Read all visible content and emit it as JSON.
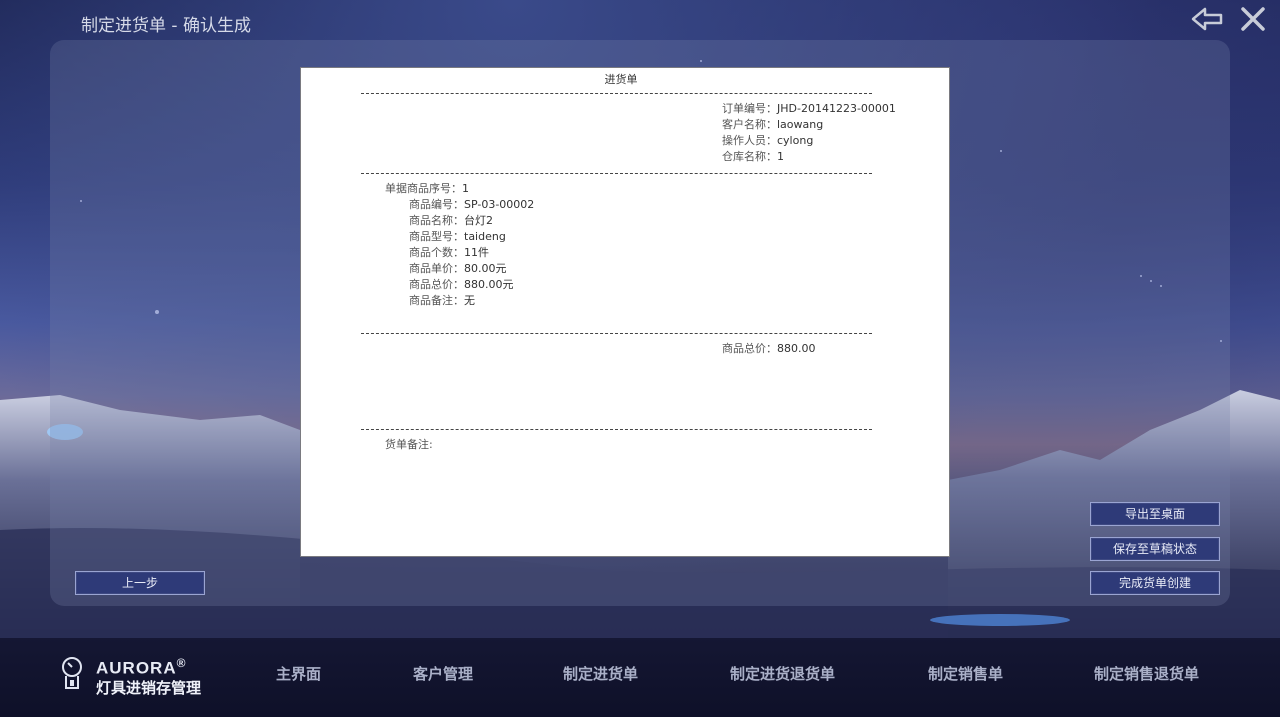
{
  "window": {
    "title": "制定进货单 - 确认生成"
  },
  "topbar": {
    "back_icon": "back-arrow-icon",
    "close_icon": "close-icon"
  },
  "document": {
    "title": "进货单",
    "header": [
      {
        "label": "订单编号：",
        "value": "JHD-20141223-00001"
      },
      {
        "label": "客户名称：",
        "value": "laowang"
      },
      {
        "label": "操作人员：",
        "value": "cylong"
      },
      {
        "label": "仓库名称：",
        "value": "1"
      }
    ],
    "item": {
      "seq_label": "单据商品序号：",
      "seq_value": "1",
      "fields": [
        {
          "label": "商品编号：",
          "value": "SP-03-00002"
        },
        {
          "label": "商品名称：",
          "value": "台灯2"
        },
        {
          "label": "商品型号：",
          "value": "taideng"
        },
        {
          "label": "商品个数：",
          "value": "11件"
        },
        {
          "label": "商品单价：",
          "value": "80.00元"
        },
        {
          "label": "商品总价：",
          "value": "880.00元"
        },
        {
          "label": "商品备注：",
          "value": "无"
        }
      ]
    },
    "total": {
      "label": "商品总价：",
      "value": "880.00"
    },
    "remark_label": "货单备注:"
  },
  "buttons": {
    "prev": "上一步",
    "export": "导出至桌面",
    "save_draft": "保存至草稿状态",
    "finish": "完成货单创建"
  },
  "logo": {
    "en": "AURORA",
    "mark": "®",
    "cn": "灯具进销存管理"
  },
  "nav": [
    {
      "label": "主界面"
    },
    {
      "label": "客户管理"
    },
    {
      "label": "制定进货单"
    },
    {
      "label": "制定进货退货单"
    },
    {
      "label": "制定销售单"
    },
    {
      "label": "制定销售退货单"
    }
  ]
}
